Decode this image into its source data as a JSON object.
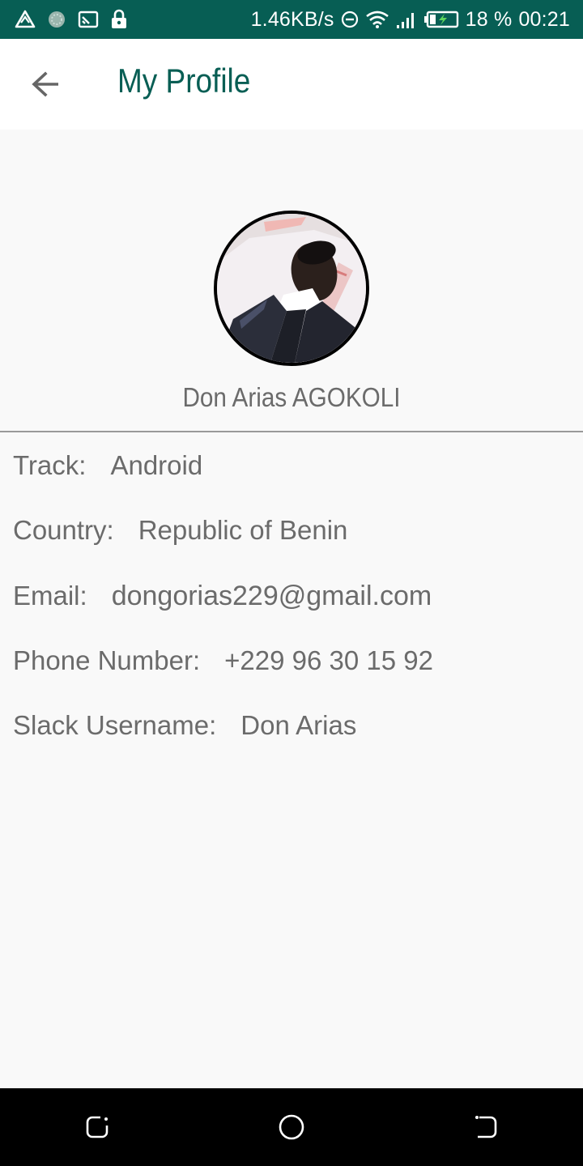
{
  "status_bar": {
    "speed": "1.46KB/s",
    "battery_percent": "18 %",
    "time": "00:21",
    "left_icons": [
      "triangle-alert-icon",
      "app-notification-icon",
      "cast-icon",
      "lock-icon"
    ],
    "right_icons": [
      "do-not-disturb-icon",
      "wifi-icon",
      "signal-icon",
      "battery-charging-icon"
    ],
    "background_color": "#075e54"
  },
  "app_bar": {
    "title": "My Profile",
    "back_icon": "arrow-left-icon",
    "title_color": "#075e54"
  },
  "profile": {
    "name": "Don Arias AGOKOLI",
    "fields": [
      {
        "label": "Track:",
        "value": "Android"
      },
      {
        "label": "Country:",
        "value": "Republic of Benin"
      },
      {
        "label": "Email:",
        "value": "dongorias229@gmail.com"
      },
      {
        "label": "Phone Number:",
        "value": "+229 96 30 15 92"
      },
      {
        "label": "Slack Username:",
        "value": "Don Arias"
      }
    ]
  },
  "nav_bar": {
    "icons": [
      "recent-apps-icon",
      "home-icon",
      "back-icon"
    ]
  }
}
